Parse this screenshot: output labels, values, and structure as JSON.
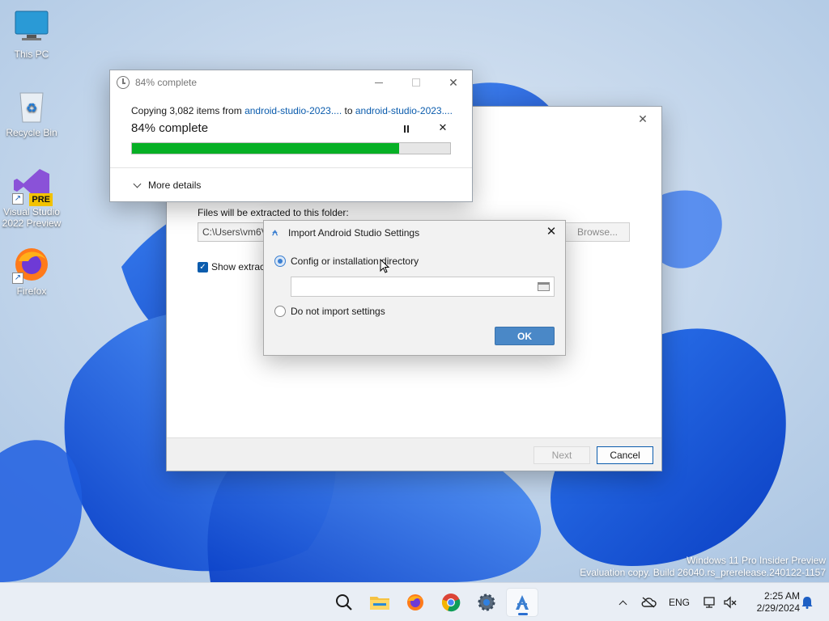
{
  "desktop": {
    "icons": [
      {
        "label": "This PC"
      },
      {
        "label": "Recycle Bin"
      },
      {
        "label": "Visual Studio 2022 Preview",
        "badge": "PRE"
      },
      {
        "label": "Firefox"
      }
    ],
    "watermark": {
      "line1": "Windows 11 Pro Insider Preview",
      "line2": "Evaluation copy. Build 26040.rs_prerelease.240122-1157"
    }
  },
  "copy_dialog": {
    "title": "84% complete",
    "prefix": "Copying 3,082 items from",
    "source": "android-studio-2023....",
    "to_word": "to",
    "dest": "android-studio-2023....",
    "progress_text": "84% complete",
    "progress": 0.84,
    "more_details": "More details"
  },
  "extract_wizard": {
    "folder_label": "Files will be extracted to this folder:",
    "path_value": "C:\\Users\\vm6V",
    "browse_label": "Browse...",
    "show_label": "Show extract",
    "show_checked": true,
    "next_label": "Next",
    "cancel_label": "Cancel"
  },
  "import_dialog": {
    "title": "Import Android Studio Settings",
    "option1": "Config or installation directory",
    "option1_selected": true,
    "path_value": "",
    "option2": "Do not import settings",
    "ok_label": "OK"
  },
  "taskbar": {
    "apps": [
      "search-icon",
      "file-explorer-icon",
      "firefox-icon",
      "chrome-icon",
      "settings-icon",
      "android-studio-icon"
    ],
    "lang": "ENG",
    "time": "2:25 AM",
    "date": "2/29/2024"
  },
  "colors": {
    "accent": "#0b5cad",
    "progress_fill": "#06b025",
    "ok_button": "#4a88c7"
  }
}
